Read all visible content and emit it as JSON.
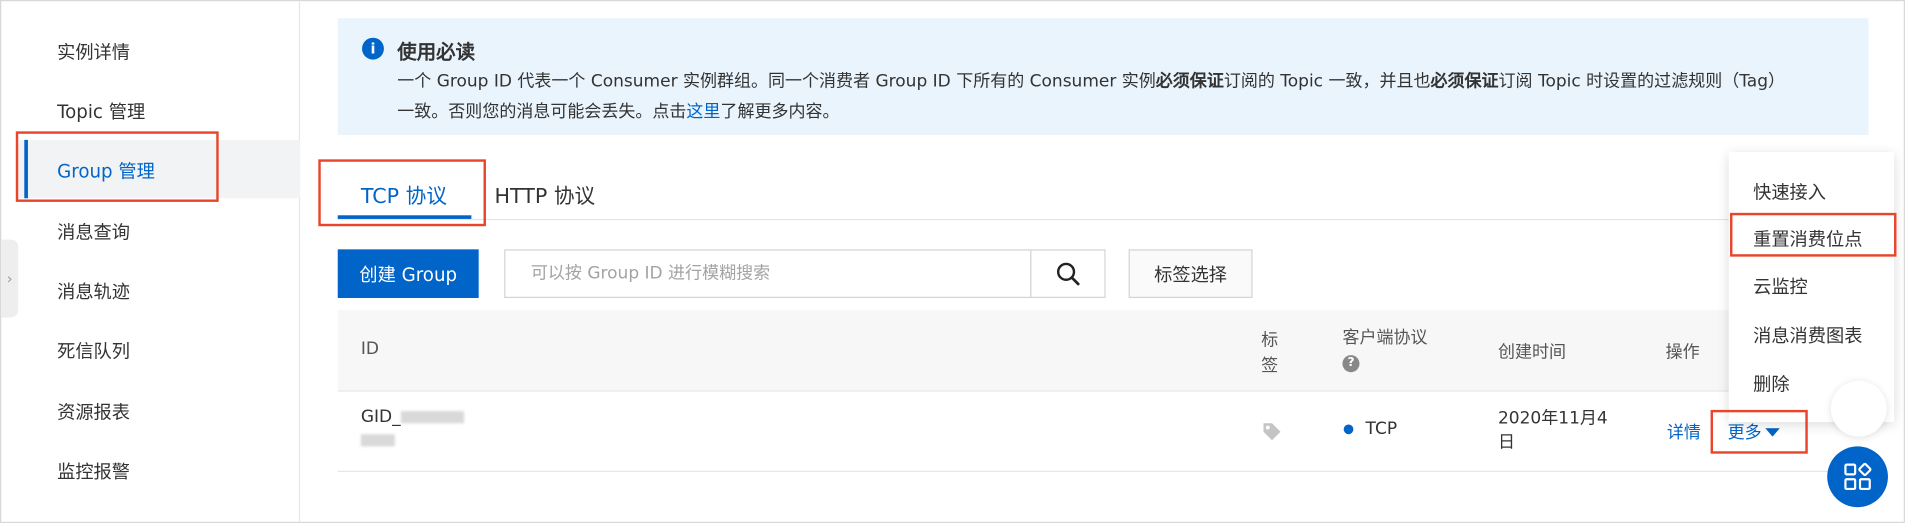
{
  "sidebar": {
    "items": [
      {
        "label": "实例详情"
      },
      {
        "label": "Topic 管理"
      },
      {
        "label": "Group 管理"
      },
      {
        "label": "消息查询"
      },
      {
        "label": "消息轨迹"
      },
      {
        "label": "死信队列"
      },
      {
        "label": "资源报表"
      },
      {
        "label": "监控报警"
      }
    ],
    "active_index": 2,
    "collapse_glyph": "›"
  },
  "notice": {
    "icon": "info-icon",
    "title": "使用必读",
    "line1_a": "一个 Group ID 代表一个 Consumer 实例群组。同一个消费者 Group ID 下所有的 Consumer 实例",
    "line1_b": "必须保证",
    "line1_c": "订阅的 Topic 一致，并且也",
    "line1_d": "必须保证",
    "line1_e": "订阅 Topic 时设置的过滤规则（Tag）",
    "line2_a": "一致。否则您的消息可能会丢失。点击",
    "line2_link": "这里",
    "line2_b": "了解更多内容。"
  },
  "tabs": [
    {
      "label": "TCP 协议",
      "active": true
    },
    {
      "label": "HTTP 协议",
      "active": false
    }
  ],
  "toolbar": {
    "create_label": "创建 Group",
    "search_placeholder": "可以按 Group ID 进行模糊搜索",
    "tag_select_label": "标签选择"
  },
  "table": {
    "headers": {
      "id": "ID",
      "tag_1": "标",
      "tag_2": "签",
      "protocol": "客户端协议",
      "created": "创建时间",
      "actions": "操作"
    },
    "rows": [
      {
        "id_prefix": "GID_",
        "protocol": "TCP",
        "created_1": "2020年11月4",
        "created_2": "日",
        "detail_label": "详情",
        "more_label": "更多"
      }
    ]
  },
  "more_menu": {
    "items": [
      {
        "label": "快速接入"
      },
      {
        "label": "重置消费位点"
      },
      {
        "label": "云监控"
      },
      {
        "label": "消息消费图表"
      },
      {
        "label": "删除"
      }
    ]
  },
  "colors": {
    "accent": "#0064c8",
    "highlight": "#e8452c",
    "notice_bg": "#e9f4fd"
  }
}
